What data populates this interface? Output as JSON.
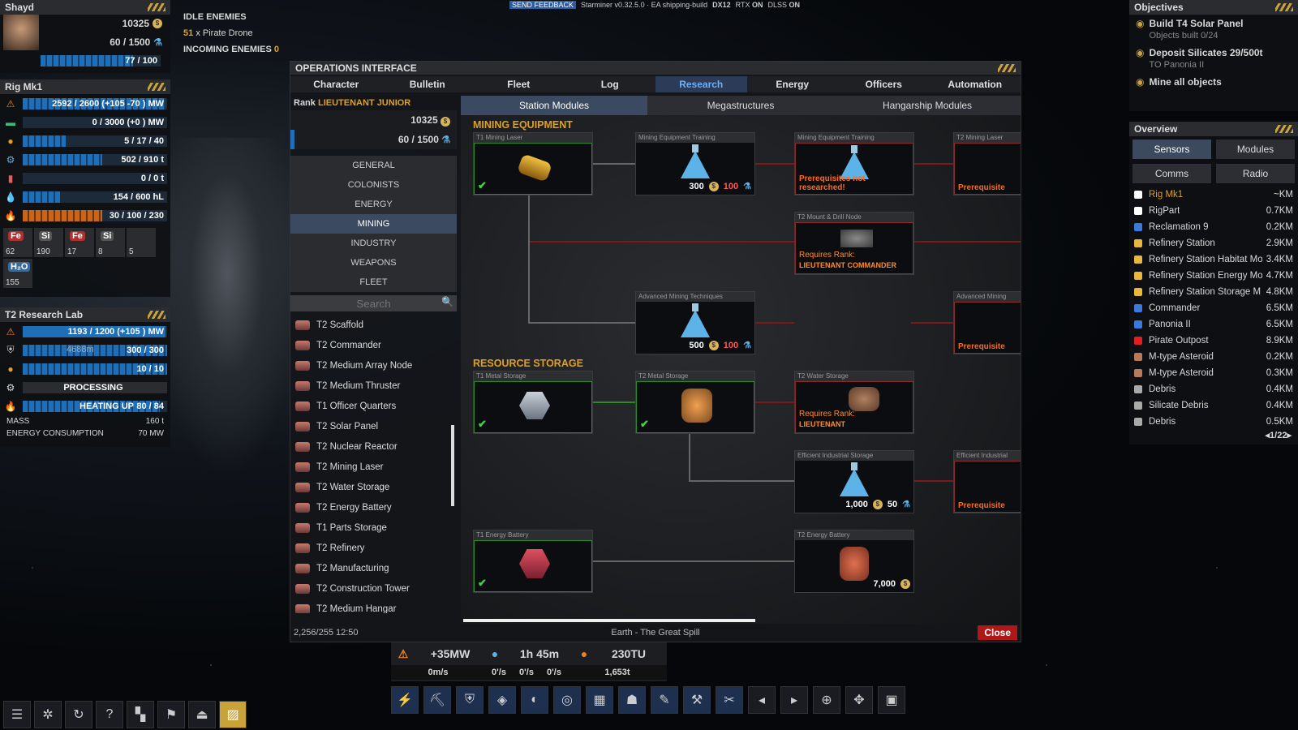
{
  "top_bar": {
    "feedback_label": "SEND FEEDBACK",
    "build_info": "Starminer v0.32.5.0 · EA shipping-build",
    "dx": "DX12",
    "rtx_label": "RTX",
    "rtx": "ON",
    "dlss_label": "DLSS",
    "dlss": "ON"
  },
  "player": {
    "name": "Shayd",
    "credits": "10325",
    "research": "60 / 1500",
    "health": "77 / 100"
  },
  "idle_enemies": {
    "title": "IDLE ENEMIES",
    "count": "51",
    "label": "x Pirate Drone",
    "incoming_label": "INCOMING ENEMIES",
    "incoming_count": "0"
  },
  "rig": {
    "title": "Rig Mk1",
    "rows": [
      {
        "icon": "power-icon",
        "value": "2592 / 2600  (+105 -70 ) MW",
        "fill": 0.99
      },
      {
        "icon": "battery-icon",
        "value": "0 / 3000  (+0 ) MW",
        "fill": 0
      },
      {
        "icon": "crew-icon",
        "value": "5 / 17 / 40",
        "fill": 0.3
      },
      {
        "icon": "cargo-icon",
        "value": "502 / 910 t",
        "fill": 0.55
      },
      {
        "icon": "parts-icon",
        "value": "0 / 0 t",
        "fill": 0
      },
      {
        "icon": "water-icon",
        "value": "154 / 600 hL",
        "fill": 0.26
      },
      {
        "icon": "heat-icon",
        "value": "30 / 100 / 230",
        "fill": 0.55
      }
    ],
    "resources": [
      {
        "sym": "Fe",
        "count": "62"
      },
      {
        "sym": "Si",
        "count": "190"
      },
      {
        "sym": "Fe",
        "count": "17"
      },
      {
        "sym": "Si",
        "count": "8"
      },
      {
        "sym": "",
        "count": "5"
      },
      {
        "sym": "H₂O",
        "count": "155"
      }
    ]
  },
  "lab": {
    "title": "T2 Research Lab",
    "power": "1193 / 1200  (+105 ) MW",
    "armor": "300 / 300",
    "crew": "10 / 10",
    "status": "PROCESSING",
    "heat_status": "HEATING UP",
    "heat": "80 / 84",
    "distance": "4688m",
    "mass_label": "MASS",
    "mass": "160 t",
    "energy_label": "ENERGY CONSUMPTION",
    "energy": "70 MW"
  },
  "ops": {
    "title": "OPERATIONS INTERFACE",
    "tabs": [
      "Character",
      "Bulletin",
      "Fleet",
      "Log",
      "Research",
      "Energy",
      "Officers",
      "Automation"
    ],
    "active_tab": 4,
    "rank_label": "Rank",
    "rank": "LIEUTENANT JUNIOR",
    "credits": "10325",
    "research": "60 / 1500",
    "categories": [
      "GENERAL",
      "COLONISTS",
      "ENERGY",
      "MINING",
      "INDUSTRY",
      "WEAPONS",
      "FLEET"
    ],
    "active_category": 3,
    "search_placeholder": "Search",
    "items": [
      "T2 Scaffold",
      "T2 Commander",
      "T2 Medium Array Node",
      "T2 Medium Thruster",
      "T1 Officer Quarters",
      "T2 Solar Panel",
      "T2 Nuclear Reactor",
      "T2 Mining Laser",
      "T2 Water Storage",
      "T2 Energy Battery",
      "T1 Parts Storage",
      "T2 Refinery",
      "T2 Manufacturing",
      "T2 Construction Tower",
      "T2 Medium Hangar"
    ],
    "subtabs": [
      "Station Modules",
      "Megastructures",
      "Hangarship Modules"
    ],
    "active_subtab": 0,
    "sections": {
      "mining": "MINING EQUIPMENT",
      "storage": "RESOURCE STORAGE"
    },
    "nodes": {
      "n1": {
        "title": "T1 Mining Laser"
      },
      "n2": {
        "title": "Mining Equipment Training",
        "cost": "300",
        "research": "100"
      },
      "n3": {
        "title": "Mining Equipment Training",
        "warn": "Prerequisites not researched!"
      },
      "n4": {
        "title": "T2 Mining Laser",
        "warn": "Prerequisite"
      },
      "n5": {
        "title": "T2 Mount & Drill Node",
        "req": "Requires Rank:",
        "rank": "LIEUTENANT COMMANDER"
      },
      "n6": {
        "title": "Advanced Mining Techniques",
        "cost": "500",
        "research": "100"
      },
      "n7": {
        "title": "Advanced Mining",
        "warn": "Prerequisite"
      },
      "n8": {
        "title": "T1 Metal Storage"
      },
      "n9": {
        "title": "T2 Metal Storage"
      },
      "n10": {
        "title": "T2 Water Storage",
        "req": "Requires Rank:",
        "rank": "LIEUTENANT"
      },
      "n11": {
        "title": "Efficient Industrial Storage",
        "cost": "1,000",
        "research": "50"
      },
      "n12": {
        "title": "Efficient Industrial",
        "warn": "Prerequisite"
      },
      "n13": {
        "title": "T1 Energy Battery"
      },
      "n14": {
        "title": "T2 Energy Battery",
        "cost": "7,000"
      }
    },
    "footer_left": "2,256/255  12:50",
    "footer_center": "Earth - The Great Spill",
    "close_label": "Close"
  },
  "status": {
    "power": "+35MW",
    "time": "1h 45m",
    "tu": "230TU",
    "speed": "0m/s",
    "rot1": "0'/s",
    "rot2": "0'/s",
    "rot3": "0'/s",
    "mass": "1,653t"
  },
  "objectives": {
    "title": "Objectives",
    "items": [
      {
        "text": "Build T4 Solar Panel",
        "sub": "Objects built 0/24"
      },
      {
        "text": "Deposit Silicates 29/500t",
        "sub": "TO Panonia II"
      },
      {
        "text": "Mine all objects",
        "sub": ""
      }
    ]
  },
  "overview": {
    "title": "Overview",
    "buttons": [
      "Sensors",
      "Modules",
      "Comms",
      "Radio"
    ],
    "rows": [
      {
        "name": "Rig Mk1",
        "dist": "~KM",
        "color": "#ffffff",
        "highlight": true
      },
      {
        "name": "RigPart",
        "dist": "0.7KM",
        "color": "#ffffff"
      },
      {
        "name": "Reclamation 9",
        "dist": "0.2KM",
        "color": "#3a7adc"
      },
      {
        "name": "Refinery Station",
        "dist": "2.9KM",
        "color": "#e8b83a"
      },
      {
        "name": "Refinery Station Habitat Mo",
        "dist": "3.4KM",
        "color": "#e8b83a"
      },
      {
        "name": "Refinery Station Energy Mo",
        "dist": "4.7KM",
        "color": "#e8b83a"
      },
      {
        "name": "Refinery Station Storage M",
        "dist": "4.8KM",
        "color": "#e8b83a"
      },
      {
        "name": "Commander",
        "dist": "6.5KM",
        "color": "#3a7adc"
      },
      {
        "name": "Panonia II",
        "dist": "6.5KM",
        "color": "#3a7adc"
      },
      {
        "name": "Pirate Outpost",
        "dist": "8.9KM",
        "color": "#e02020"
      },
      {
        "name": "M-type Asteroid",
        "dist": "0.2KM",
        "color": "#b87a5a"
      },
      {
        "name": "M-type Asteroid",
        "dist": "0.3KM",
        "color": "#b87a5a"
      },
      {
        "name": "Debris",
        "dist": "0.4KM",
        "color": "#aaaaaa"
      },
      {
        "name": "Silicate Debris",
        "dist": "0.4KM",
        "color": "#aaaaaa"
      },
      {
        "name": "Debris",
        "dist": "0.5KM",
        "color": "#aaaaaa"
      }
    ],
    "page": "1/22"
  }
}
